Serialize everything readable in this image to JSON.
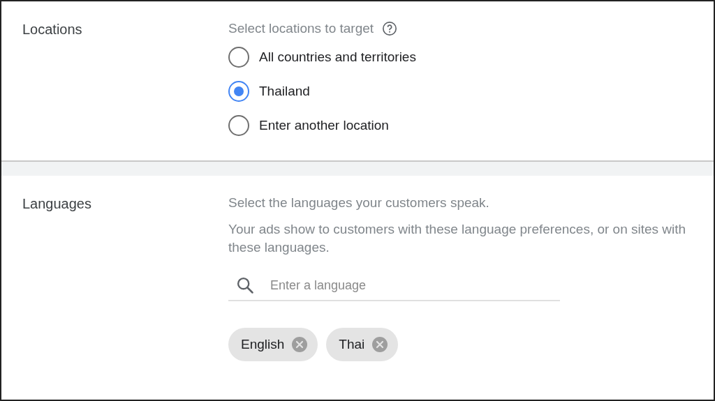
{
  "locations": {
    "title": "Locations",
    "prompt": "Select locations to target",
    "options": [
      {
        "label": "All countries and territories",
        "selected": false
      },
      {
        "label": "Thailand",
        "selected": true
      },
      {
        "label": "Enter another location",
        "selected": false
      }
    ]
  },
  "languages": {
    "title": "Languages",
    "prompt": "Select the languages your customers speak.",
    "description": "Your ads show to customers with these language preferences, or on sites with these languages.",
    "search": {
      "placeholder": "Enter a language"
    },
    "chips": [
      {
        "label": "English"
      },
      {
        "label": "Thai"
      }
    ]
  }
}
